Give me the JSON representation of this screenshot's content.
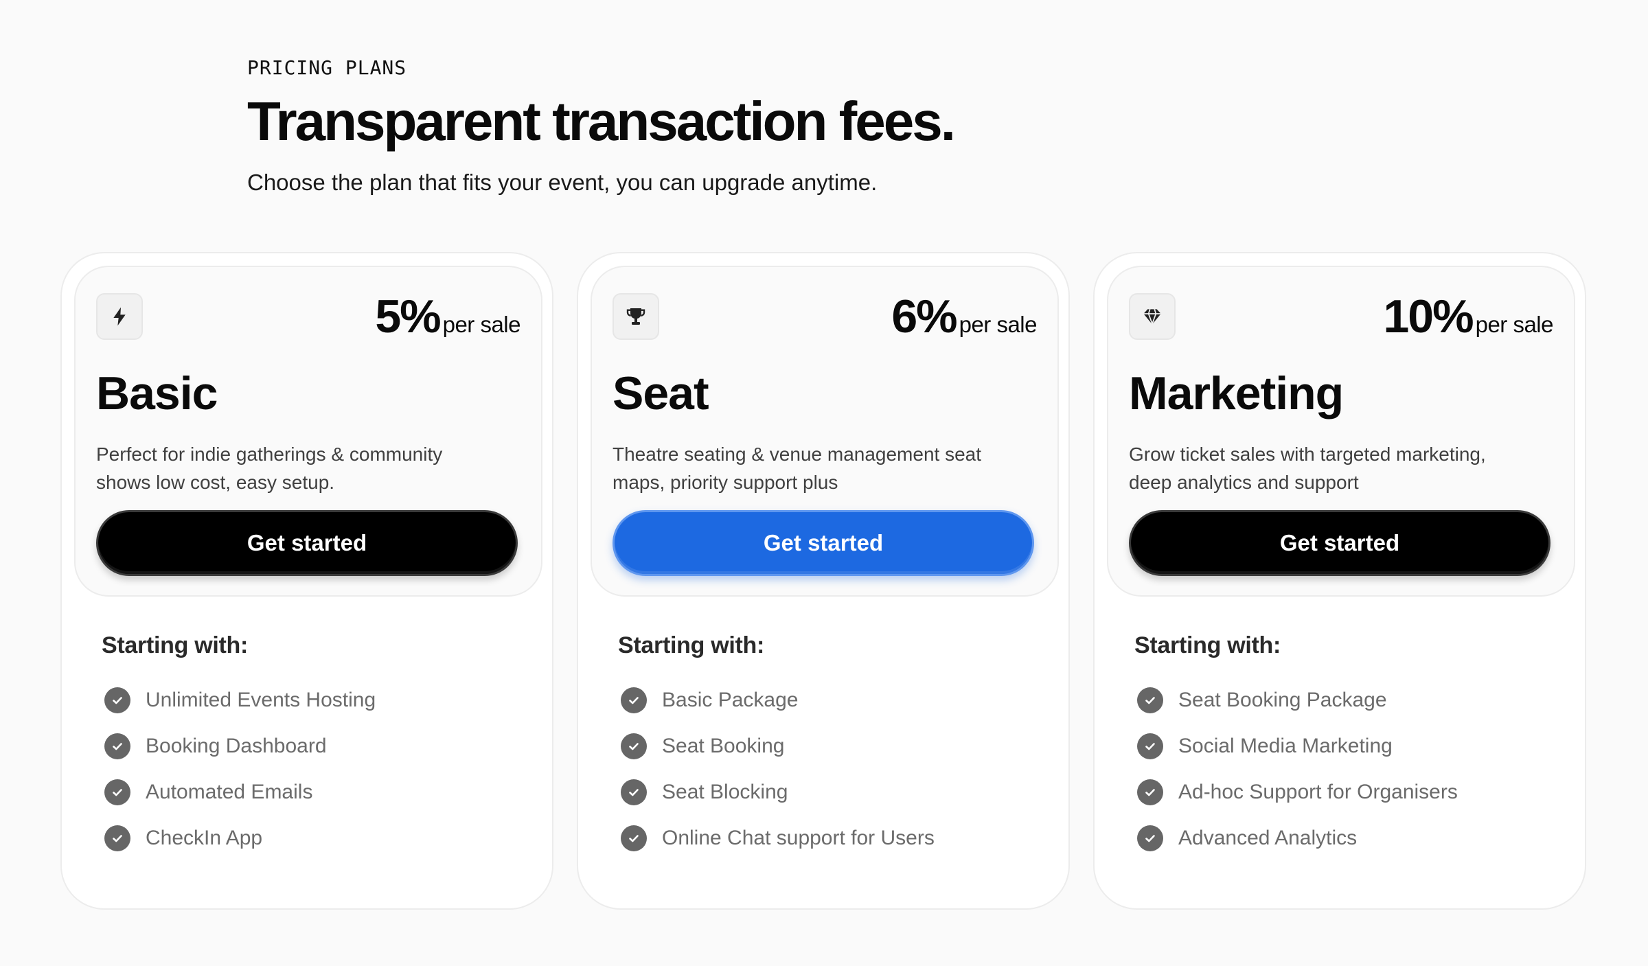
{
  "header": {
    "eyebrow": "PRICING PLANS",
    "title": "Transparent transaction fees.",
    "subtitle": "Choose the plan that fits your event, you can upgrade anytime."
  },
  "colors": {
    "primary_cta": "#1d69e1",
    "dark_cta": "#000000",
    "check_icon": "#666666"
  },
  "plans": [
    {
      "icon": "lightning-icon",
      "price": "5%",
      "price_unit": "per sale",
      "name": "Basic",
      "description": "Perfect for indie gatherings & community shows  low cost, easy setup.",
      "cta_label": "Get started",
      "features_title": "Starting with:",
      "features": [
        "Unlimited Events Hosting",
        "Booking Dashboard",
        "Automated Emails",
        "CheckIn App"
      ]
    },
    {
      "icon": "trophy-icon",
      "price": "6%",
      "price_unit": "per sale",
      "name": "Seat",
      "description": "Theatre seating & venue management seat maps, priority support plus",
      "cta_label": "Get started",
      "features_title": "Starting with:",
      "features": [
        "Basic Package",
        "Seat Booking",
        "Seat Blocking",
        "Online Chat support for Users"
      ]
    },
    {
      "icon": "diamond-icon",
      "price": "10%",
      "price_unit": "per sale",
      "name": "Marketing",
      "description": "Grow ticket sales with targeted marketing, deep analytics and support",
      "cta_label": "Get started",
      "features_title": "Starting with:",
      "features": [
        "Seat Booking Package",
        "Social Media Marketing",
        "Ad-hoc Support for Organisers",
        "Advanced Analytics"
      ]
    }
  ]
}
